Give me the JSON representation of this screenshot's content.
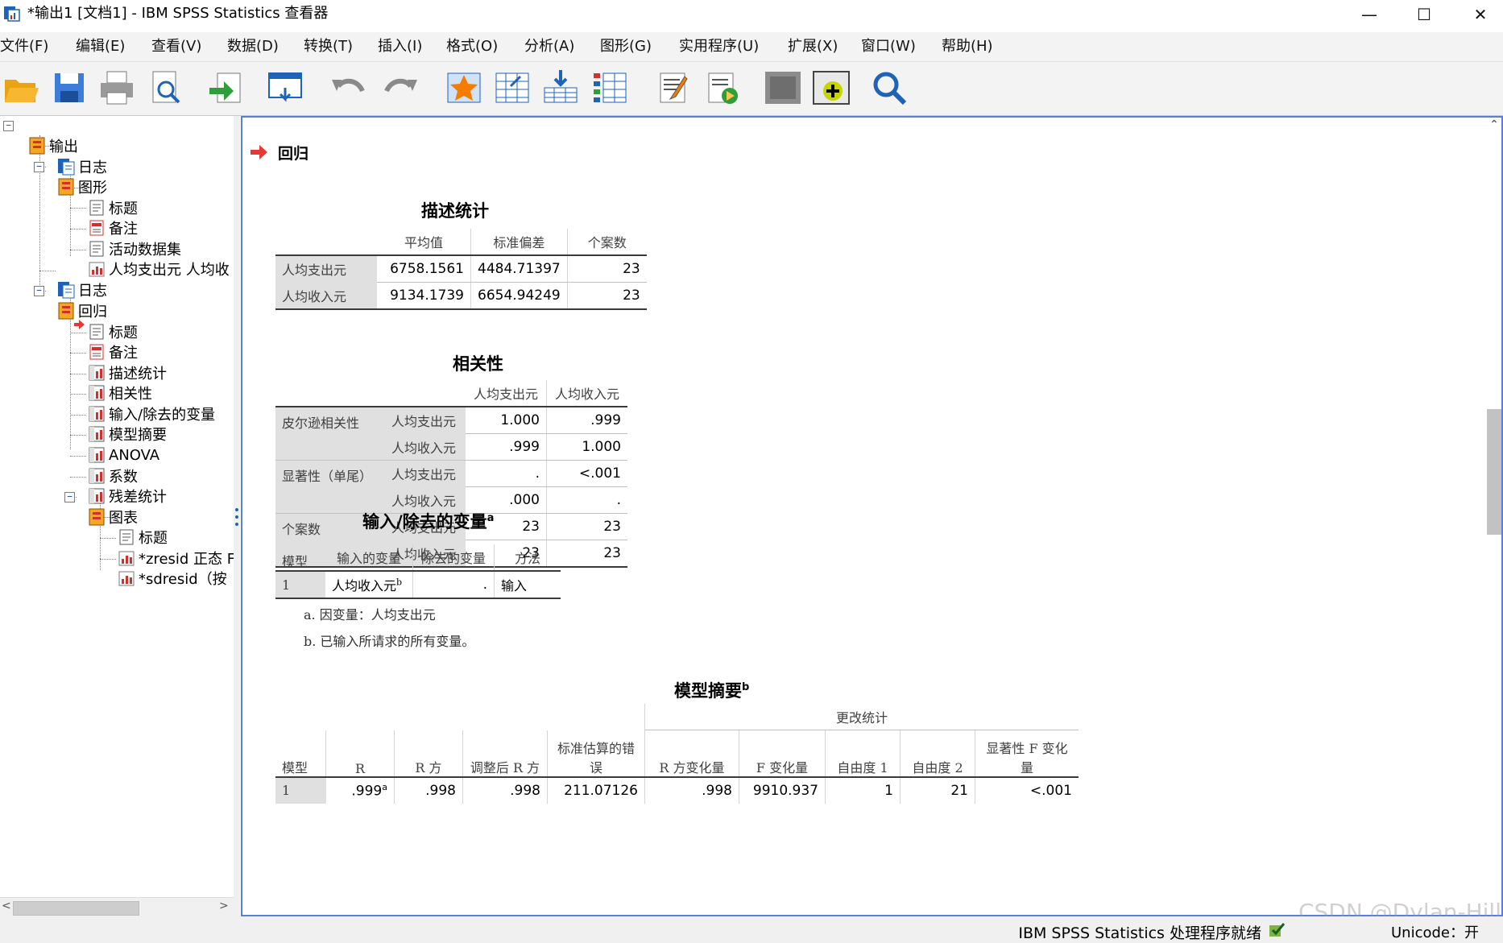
{
  "window": {
    "title": "*输出1 [文档1] - IBM SPSS Statistics 查看器",
    "minimize": "—",
    "maximize": "☐",
    "close": "✕"
  },
  "menu": [
    "文件(F)",
    "编辑(E)",
    "查看(V)",
    "数据(D)",
    "转换(T)",
    "插入(I)",
    "格式(O)",
    "分析(A)",
    "图形(G)",
    "实用程序(U)",
    "扩展(X)",
    "窗口(W)",
    "帮助(H)"
  ],
  "toolbar_icons": [
    "open-icon",
    "save-icon",
    "print-icon",
    "print-preview-icon",
    "export-icon",
    "recall-dialog-icon",
    "undo-icon",
    "redo-icon",
    "goto-data-icon",
    "goto-case-icon",
    "insert-heading-icon",
    "variables-icon",
    "insert-title-icon",
    "insert-text-icon",
    "show-hide-icon",
    "insert-chart-icon",
    "search-icon"
  ],
  "tree": {
    "output": "输出",
    "log": "日志",
    "graph": "图形",
    "graph_title": "标题",
    "graph_notes": "备注",
    "graph_dataset": "活动数据集",
    "graph_chart": "人均支出元 人均收",
    "log2": "日志",
    "regression": "回归",
    "reg_title": "标题",
    "reg_notes": "备注",
    "reg_desc": "描述统计",
    "reg_corr": "相关性",
    "reg_entered": "输入/除去的变量",
    "reg_summary": "模型摘要",
    "reg_anova": "ANOVA",
    "reg_coef": "系数",
    "reg_resid": "残差统计",
    "charts": "图表",
    "charts_title": "标题",
    "charts_zresid": "*zresid 正态 F",
    "charts_sdresid": "*sdresid（按"
  },
  "content": {
    "heading": "回归",
    "desc": {
      "title": "描述统计",
      "headers": [
        "平均值",
        "标准偏差",
        "个案数"
      ],
      "rows": [
        {
          "label": "人均支出元",
          "mean": "6758.1561",
          "sd": "4484.71397",
          "n": "23"
        },
        {
          "label": "人均收入元",
          "mean": "9134.1739",
          "sd": "6654.94249",
          "n": "23"
        }
      ]
    },
    "corr": {
      "title": "相关性",
      "headers": [
        "人均支出元",
        "人均收入元"
      ],
      "groups": [
        "皮尔逊相关性",
        "显著性（单尾）",
        "个案数"
      ],
      "vars": [
        "人均支出元",
        "人均收入元"
      ],
      "values": [
        [
          "1.000",
          ".999"
        ],
        [
          ".999",
          "1.000"
        ],
        [
          ".",
          "<.001"
        ],
        [
          ".000",
          "."
        ],
        [
          "23",
          "23"
        ],
        [
          "23",
          "23"
        ]
      ]
    },
    "entered": {
      "title": "输入/除去的变量",
      "sup": "a",
      "headers": [
        "模型",
        "输入的变量",
        "除去的变量",
        "方法"
      ],
      "row": {
        "model": "1",
        "entered": "人均收入元",
        "entered_sup": "b",
        "removed": ".",
        "method": "输入"
      },
      "notes": [
        "a. 因变量：人均支出元",
        "b. 已输入所请求的所有变量。"
      ]
    },
    "summary": {
      "title": "模型摘要",
      "sup": "b",
      "group_header": "更改统计",
      "headers": [
        "模型",
        "R",
        "R 方",
        "调整后 R 方",
        "标准估算的错误",
        "R 方变化量",
        "F 变化量",
        "自由度 1",
        "自由度 2",
        "显著性 F 变化量"
      ],
      "row": {
        "model": "1",
        "r": ".999",
        "r_sup": "a",
        "r2": ".998",
        "adj_r2": ".998",
        "se": "211.07126",
        "r2_change": ".998",
        "f_change": "9910.937",
        "df1": "1",
        "df2": "21",
        "sig": "<.001"
      }
    }
  },
  "status": {
    "processor": "IBM SPSS Statistics 处理程序就绪",
    "unicode": "Unicode：开",
    "watermark": "CSDN @Dylan-Hill"
  }
}
